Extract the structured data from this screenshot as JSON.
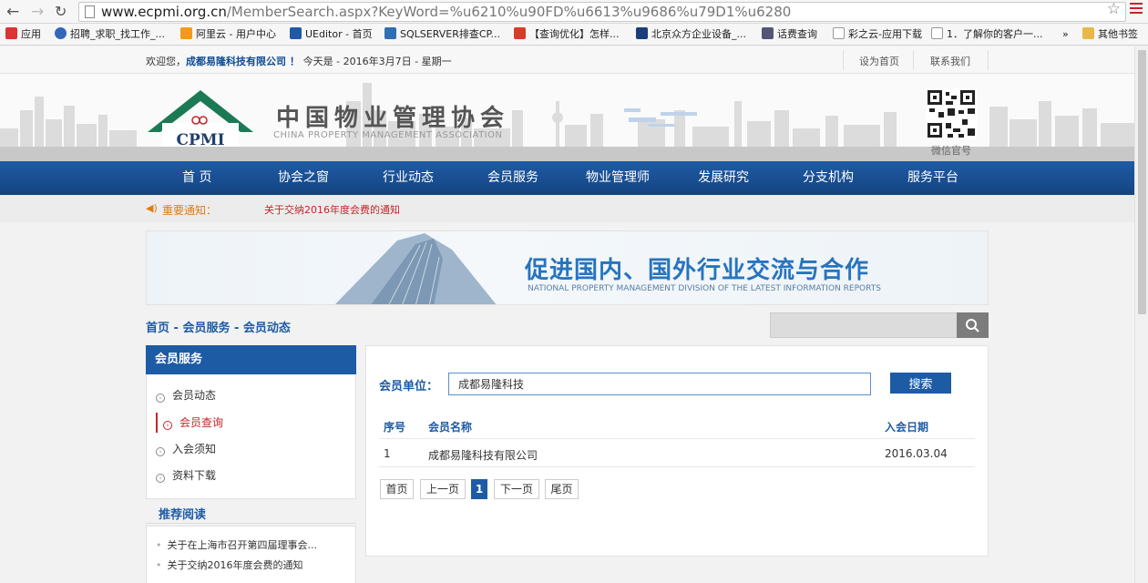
{
  "browser": {
    "url_host": "www.ecpmi.org.cn",
    "url_path": "/MemberSearch.aspx?KeyWord=%u6210%u90FD%u6613%u9686%u79D1%u6280",
    "bookmarks": [
      {
        "label": "应用",
        "color": "#d33"
      },
      {
        "label": "招聘_求职_找工作_...",
        "color": "#3467b6"
      },
      {
        "label": "阿里云 - 用户中心",
        "color": "#f39a1a"
      },
      {
        "label": "UEditor - 首页",
        "color": "#2159a8"
      },
      {
        "label": "SQLSERVER排查CP...",
        "color": "#2f6fb4"
      },
      {
        "label": "【查询优化】怎样...",
        "color": "#d83b2a"
      },
      {
        "label": "北京众方企业设备_...",
        "color": "#1b3e7a"
      },
      {
        "label": "话费查询",
        "color": "#557"
      },
      {
        "label": "彩之云-应用下载",
        "color": "#aaa"
      },
      {
        "label": "1．了解你的客户一...",
        "color": "#aaa"
      },
      {
        "label": "»",
        "color": ""
      },
      {
        "label": "其他书签",
        "color": "#e8b84a"
      }
    ]
  },
  "topbar": {
    "welcome_prefix": "欢迎您，",
    "company": "成都易隆科技有限公司",
    "exclaim": " ！ ",
    "date": "今天是 - 2016年3月7日 - 星期一",
    "set_home": "设为首页",
    "contact": "联系我们"
  },
  "header": {
    "logo_abbr": "CPMI",
    "title": "中国物业管理协会",
    "subtitle": "CHINA PROPERTY MANAGEMENT ASSOCIATION",
    "qr_label": "微信官号"
  },
  "nav": [
    "首 页",
    "协会之窗",
    "行业动态",
    "会员服务",
    "物业管理师",
    "发展研究",
    "分支机构",
    "服务平台"
  ],
  "notice": {
    "label": "重要通知：",
    "text": "关于交纳2016年度会费的通知"
  },
  "banner": {
    "main": "促进国内、国外行业交流与合作",
    "sub": "NATIONAL PROPERTY MANAGEMENT DIVISION OF THE LATEST INFORMATION REPORTS"
  },
  "breadcrumb": "首页 - 会员服务 - 会员动态",
  "sidebar": {
    "title": "会员服务",
    "items": [
      "会员动态",
      "会员查询",
      "入会须知",
      "资料下载"
    ],
    "active_index": 1
  },
  "recommend": {
    "title": "推荐阅读",
    "items": [
      "关于在上海市召开第四届理事会...",
      "关于交纳2016年度会费的通知"
    ]
  },
  "search_form": {
    "label": "会员单位：",
    "value": "成都易隆科技",
    "button": "搜索"
  },
  "table": {
    "headers": [
      "序号",
      "会员名称",
      "入会日期"
    ],
    "rows": [
      {
        "no": "1",
        "name": "成都易隆科技有限公司",
        "date": "2016.03.04"
      }
    ]
  },
  "pager": [
    "首页",
    "上一页",
    "1",
    "下一页",
    "尾页"
  ]
}
